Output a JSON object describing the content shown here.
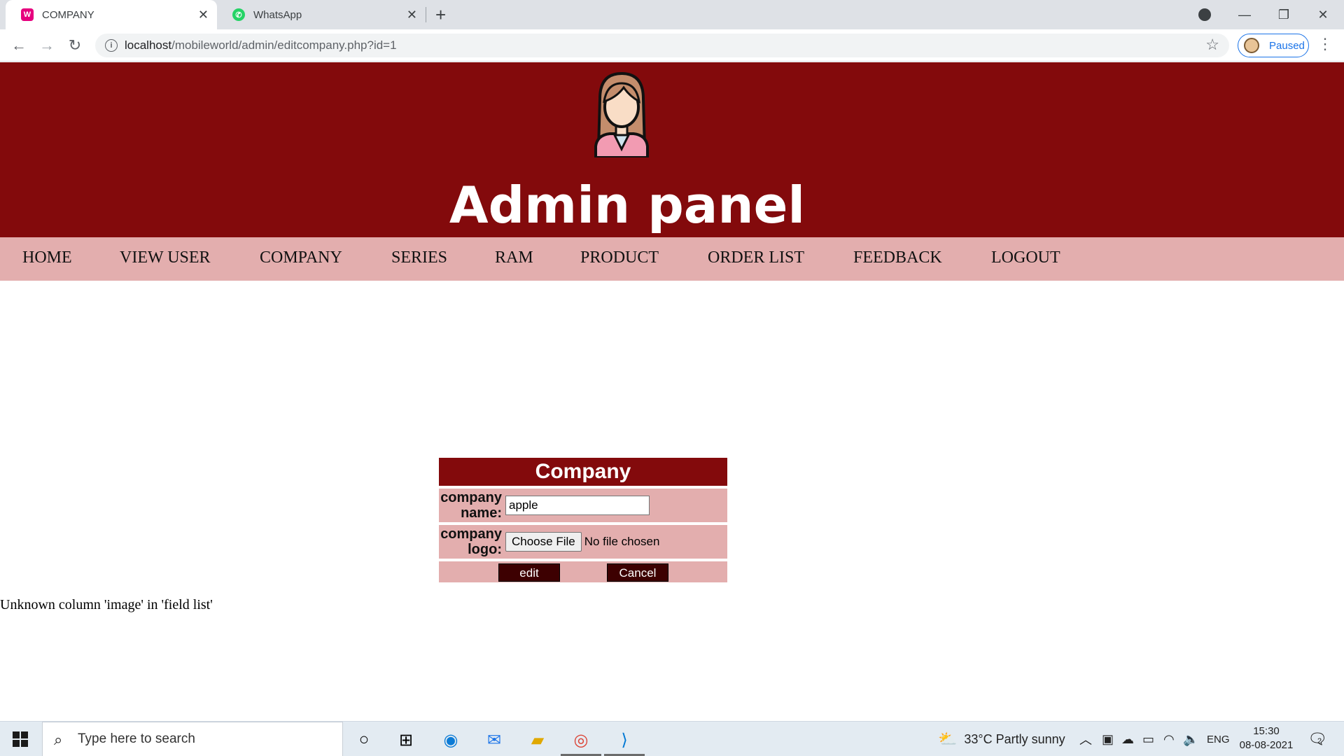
{
  "browser": {
    "tabs": [
      {
        "title": "COMPANY",
        "favicon": "wamp-icon",
        "active": true
      },
      {
        "title": "WhatsApp",
        "favicon": "whatsapp-icon",
        "active": false
      }
    ],
    "url_host": "localhost",
    "url_path": "/mobileworld/admin/editcompany.php?id=1",
    "profile_status": "Paused"
  },
  "header": {
    "title": "Admin panel",
    "avatar_icon": "admin-woman-avatar-icon",
    "bg_color": "#830a0c"
  },
  "nav": {
    "items": [
      "HOME",
      "VIEW USER",
      "COMPANY",
      "SERIES",
      "RAM",
      "PRODUCT",
      "ORDER LIST",
      "FEEDBACK",
      "LOGOUT"
    ],
    "bg_color": "#e3aeae"
  },
  "form": {
    "heading": "Company",
    "name_label_1": "company",
    "name_label_2": "name:",
    "name_value": "apple",
    "logo_label_1": "company",
    "logo_label_2": "logo:",
    "file_button": "Choose File",
    "file_status": "No file chosen",
    "submit_label": "edit",
    "cancel_label": "Cancel"
  },
  "error_message": "Unknown column 'image' in 'field list'",
  "taskbar": {
    "search_placeholder": "Type here to search",
    "weather": "33°C  Partly sunny",
    "language": "ENG",
    "time": "15:30",
    "date": "08-08-2021",
    "notifications": "2"
  }
}
